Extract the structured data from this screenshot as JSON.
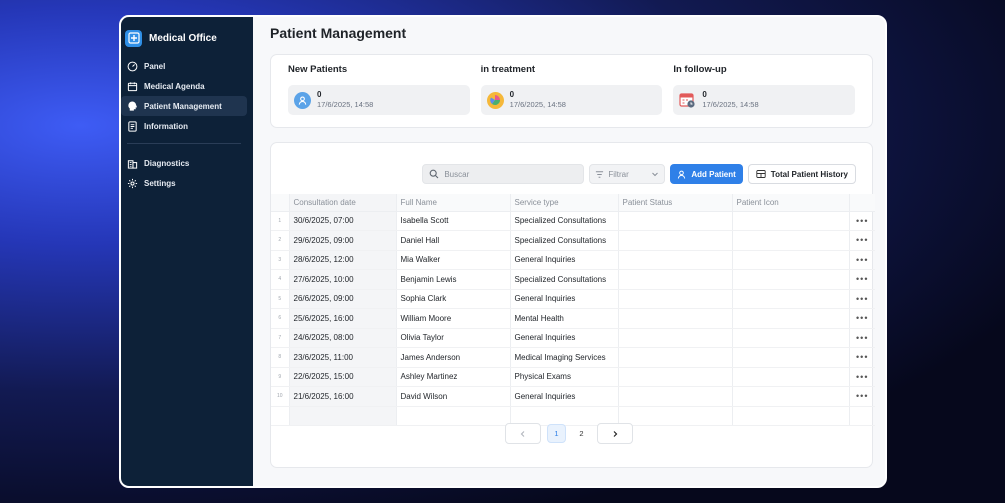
{
  "app": {
    "title": "Medical Office"
  },
  "sidebar": {
    "items": [
      {
        "label": "Panel",
        "icon": "gauge-icon"
      },
      {
        "label": "Medical Agenda",
        "icon": "calendar-icon"
      },
      {
        "label": "Patient Management",
        "icon": "head-icon",
        "active": true
      },
      {
        "label": "Information",
        "icon": "document-icon"
      },
      {
        "label": "Diagnostics",
        "icon": "building-icon"
      },
      {
        "label": "Settings",
        "icon": "gear-icon"
      }
    ]
  },
  "page": {
    "title": "Patient Management"
  },
  "stats": [
    {
      "title": "New Patients",
      "value": "0",
      "date": "17/6/2025, 14:58",
      "icon": "user-badge-icon",
      "color": "#5ba3e8"
    },
    {
      "title": "in treatment",
      "value": "0",
      "date": "17/6/2025, 14:58",
      "icon": "pie-chart-icon",
      "color": "#f5b83a"
    },
    {
      "title": "In follow-up",
      "value": "0",
      "date": "17/6/2025, 14:58",
      "icon": "calendar-clock-icon",
      "color": "#e25a5a"
    }
  ],
  "toolbar": {
    "search_placeholder": "Buscar",
    "filter_label": "Filtrar",
    "add_label": "Add Patient",
    "history_label": "Total Patient History"
  },
  "table": {
    "columns": [
      "Consultation date",
      "Full Name",
      "Service type",
      "Patient Status",
      "Patient Icon"
    ],
    "rows": [
      {
        "n": "1",
        "date": "30/6/2025, 07:00",
        "name": "Isabella Scott",
        "service": "Specialized Consultations"
      },
      {
        "n": "2",
        "date": "29/6/2025, 09:00",
        "name": "Daniel Hall",
        "service": "Specialized Consultations"
      },
      {
        "n": "3",
        "date": "28/6/2025, 12:00",
        "name": "Mia Walker",
        "service": "General Inquiries"
      },
      {
        "n": "4",
        "date": "27/6/2025, 10:00",
        "name": "Benjamin Lewis",
        "service": "Specialized Consultations"
      },
      {
        "n": "5",
        "date": "26/6/2025, 09:00",
        "name": "Sophia Clark",
        "service": "General Inquiries"
      },
      {
        "n": "6",
        "date": "25/6/2025, 16:00",
        "name": "William Moore",
        "service": "Mental Health"
      },
      {
        "n": "7",
        "date": "24/6/2025, 08:00",
        "name": "Olivia Taylor",
        "service": "General Inquiries"
      },
      {
        "n": "8",
        "date": "23/6/2025, 11:00",
        "name": "James Anderson",
        "service": "Medical Imaging Services"
      },
      {
        "n": "9",
        "date": "22/6/2025, 15:00",
        "name": "Ashley Martinez",
        "service": "Physical Exams"
      },
      {
        "n": "10",
        "date": "21/6/2025, 16:00",
        "name": "David Wilson",
        "service": "General Inquiries"
      }
    ],
    "more_label": "•••"
  },
  "pagination": {
    "pages": [
      "1",
      "2"
    ],
    "current": "1"
  }
}
